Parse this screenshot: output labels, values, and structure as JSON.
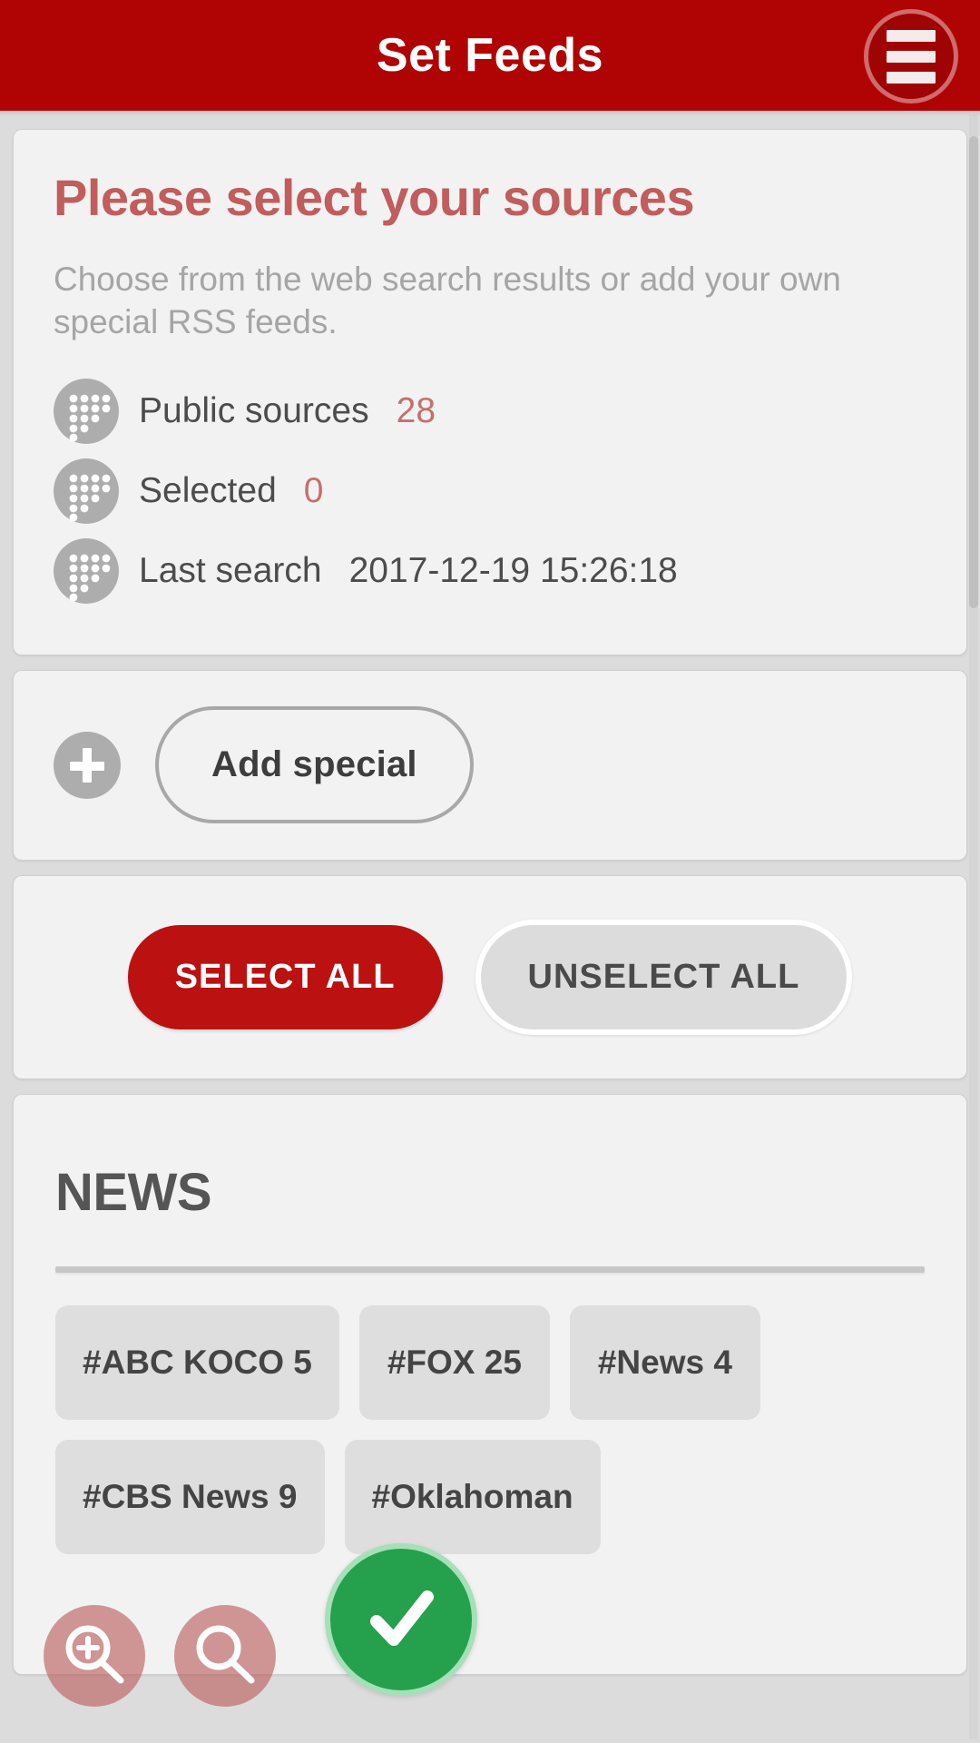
{
  "header": {
    "title": "Set Feeds",
    "menu_icon": "hamburger-menu-icon",
    "background_color": "#b00404",
    "title_color": "#ffffff"
  },
  "info": {
    "title": "Please select your sources",
    "description": "Choose from the web search results or add your own special RSS feeds.",
    "title_color": "#c15d5d",
    "stats": [
      {
        "icon": "dots-icon",
        "label": "Public sources",
        "value": "28"
      },
      {
        "icon": "dots-icon",
        "label": "Selected",
        "value": "0"
      },
      {
        "icon": "dots-icon",
        "label": "Last search",
        "value": "2017-12-19 15:26:18"
      }
    ],
    "value_color": "#c4706c"
  },
  "add_section": {
    "plus_icon": "plus-circle-icon",
    "button_label": "Add special"
  },
  "bulk_actions": {
    "select_all_label": "SELECT ALL",
    "unselect_all_label": "UNSELECT ALL",
    "select_all_color": "#bb1111",
    "unselect_all_color": "#dcdcdc"
  },
  "news_section": {
    "heading": "NEWS",
    "chips": [
      {
        "label": "#ABC KOCO 5"
      },
      {
        "label": "#FOX 25"
      },
      {
        "label": "#News 4"
      },
      {
        "label": "#CBS News 9"
      },
      {
        "label": "#Oklahoman"
      }
    ]
  },
  "overlays": {
    "zoom_in_icon": "magnifier-plus-icon",
    "zoom_out_icon": "magnifier-minus-icon",
    "confirm_icon": "checkmark-icon",
    "confirm_color": "#25a04c",
    "zoom_button_color": "#ba5c5c"
  }
}
